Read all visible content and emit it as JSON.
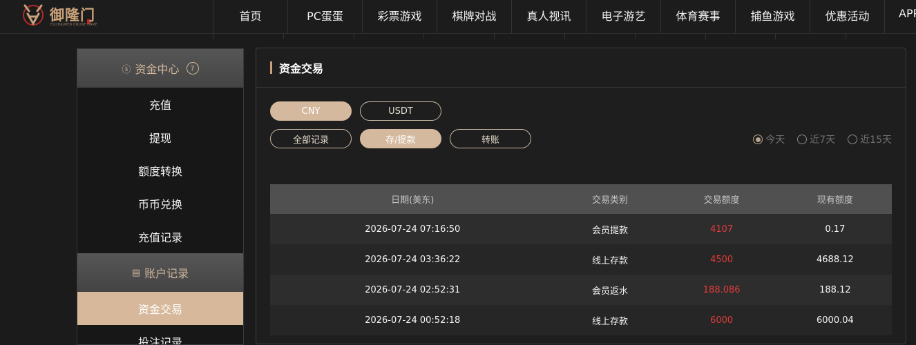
{
  "brand": {
    "name": "御隆门",
    "subtitle": "YULONGMEN ONLINE GAME"
  },
  "nav": [
    "首页",
    "PC蛋蛋",
    "彩票游戏",
    "棋牌对战",
    "真人视讯",
    "电子游艺",
    "体育赛事",
    "捕鱼游戏",
    "优惠活动",
    "APP"
  ],
  "sidebar": {
    "section1": {
      "title": "资金中心",
      "icon": "coin-icon",
      "help": "?"
    },
    "items1": [
      "充值",
      "提现",
      "额度转换",
      "币币兑换",
      "充值记录"
    ],
    "section2": {
      "title": "账户记录",
      "icon": "document-icon"
    },
    "items2": [
      "资金交易",
      "投注记录"
    ],
    "active": "资金交易"
  },
  "panel": {
    "title": "资金交易",
    "currency": [
      "CNY",
      "USDT"
    ],
    "currency_selected": "CNY",
    "record_types": [
      "全部记录",
      "存/提款",
      "转账"
    ],
    "record_selected": "存/提款",
    "ranges": [
      "今天",
      "近7天",
      "近15天"
    ],
    "range_selected": "今天"
  },
  "table": {
    "headers": [
      "日期(美东)",
      "交易类别",
      "交易额度",
      "现有额度"
    ],
    "rows": [
      [
        "2026-07-24 07:16:50",
        "会员提款",
        "4107",
        "0.17"
      ],
      [
        "2026-07-24 03:36:22",
        "线上存款",
        "4500",
        "4688.12"
      ],
      [
        "2026-07-24 02:52:31",
        "会员返水",
        "188.086",
        "188.12"
      ],
      [
        "2026-07-24 00:52:18",
        "线上存款",
        "6000",
        "6000.04"
      ]
    ]
  },
  "colors": {
    "accent": "#d4b99e",
    "amount": "#e33b3b",
    "bg": "#1b1b1b"
  }
}
